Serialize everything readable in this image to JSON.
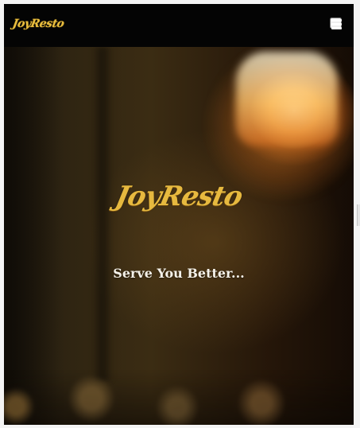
{
  "navbar": {
    "brand": "JoyResto",
    "menu_icon": "hamburger-menu-icon"
  },
  "hero": {
    "brand": "JoyResto",
    "tagline": "Serve You Better..."
  },
  "colors": {
    "navbar_background": "#040404",
    "brand_gold": "#e7b93f",
    "tagline_text": "#f4f1e9",
    "warm_lamp": "#ffb853"
  }
}
